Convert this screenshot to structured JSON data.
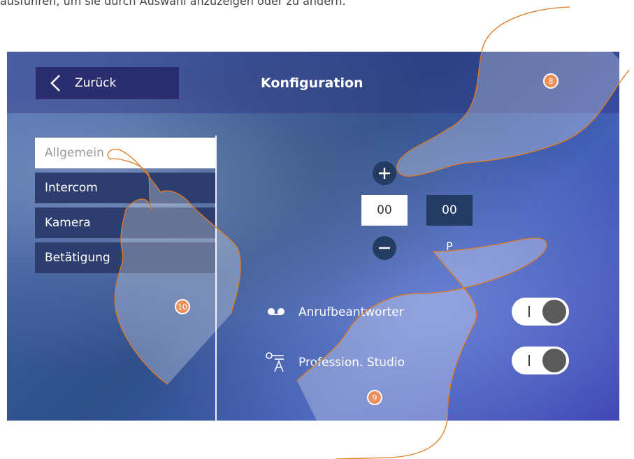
{
  "caption": "ausführen, um sie durch Auswahl anzuzeigen oder zu ändern.",
  "header": {
    "back_label": "Zurück",
    "title": "Konfiguration"
  },
  "sidebar": {
    "items": [
      {
        "label": "Allgemein",
        "active": true
      },
      {
        "label": "Intercom",
        "active": false
      },
      {
        "label": "Kamera",
        "active": false
      },
      {
        "label": "Betätigung",
        "active": false
      }
    ]
  },
  "address": {
    "value_1": "00",
    "value_2": "00",
    "p_label": "P"
  },
  "options": [
    {
      "label": "Anrufbeantworter",
      "icon": "answering-machine-icon",
      "enabled": true
    },
    {
      "label": "Profession. Studio",
      "icon": "professional-studio-icon",
      "enabled": true
    }
  ],
  "callouts": {
    "c8": "8",
    "c9": "9",
    "c10": "10"
  },
  "colors": {
    "callout": "#e8641c",
    "hand_outline": "#e07a1e",
    "panel": "#2c3d6e"
  }
}
